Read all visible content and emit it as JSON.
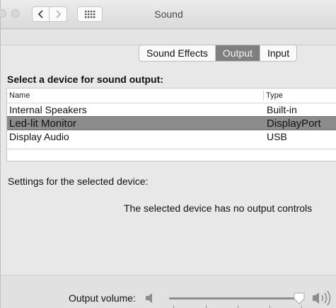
{
  "window": {
    "title": "Sound"
  },
  "tabs": [
    {
      "label": "Sound Effects",
      "selected": false
    },
    {
      "label": "Output",
      "selected": true
    },
    {
      "label": "Input",
      "selected": false
    }
  ],
  "output": {
    "heading": "Select a device for sound output:",
    "columns": {
      "name": "Name",
      "type": "Type"
    },
    "devices": [
      {
        "name": "Internal Speakers",
        "type": "Built-in",
        "selected": false
      },
      {
        "name": "Led-lit Monitor",
        "type": "DisplayPort",
        "selected": true
      },
      {
        "name": "Display Audio",
        "type": "USB",
        "selected": false
      }
    ],
    "settings_label": "Settings for the selected device:",
    "no_controls_message": "The selected device has no output controls"
  },
  "volume": {
    "label": "Output volume:",
    "level": 0.99,
    "low_icon": "speaker-low-icon",
    "high_icon": "speaker-high-icon"
  },
  "icons": {
    "back": "chevron-left-icon",
    "forward": "chevron-right-icon",
    "show_all": "grid-icon"
  }
}
